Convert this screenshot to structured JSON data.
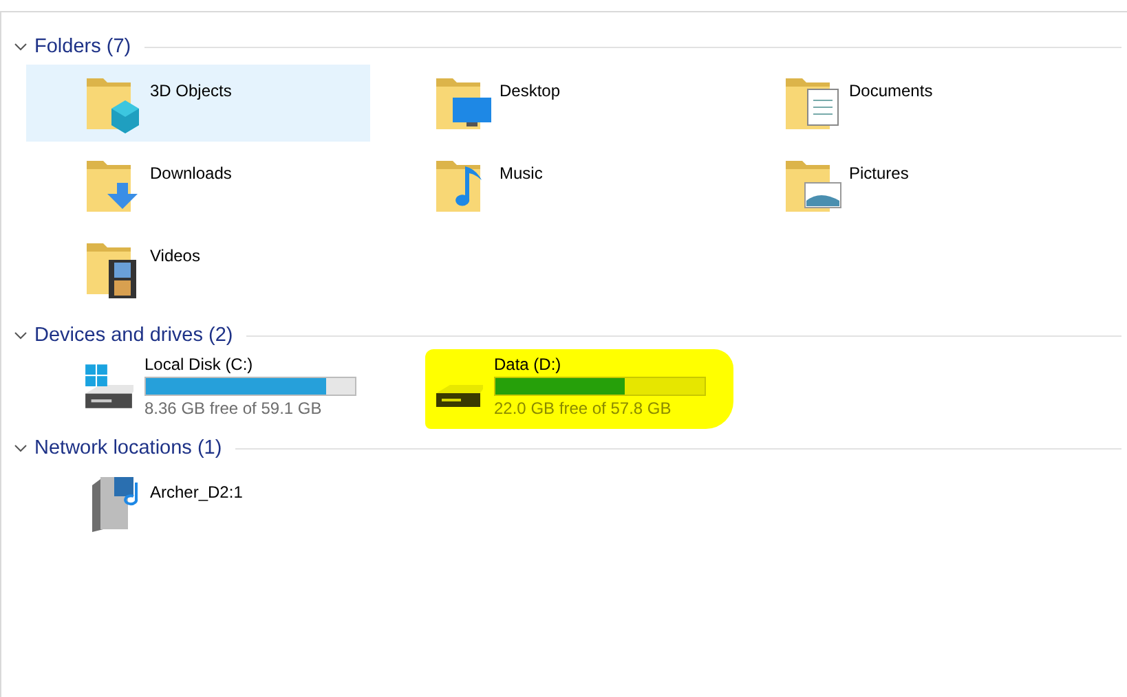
{
  "sections": [
    {
      "title": "Folders (7)",
      "expanded": true,
      "kind": "folders",
      "items": [
        {
          "name": "3D Objects",
          "kind": "cube",
          "selected": true
        },
        {
          "name": "Desktop",
          "kind": "desktop",
          "selected": false
        },
        {
          "name": "Documents",
          "kind": "document",
          "selected": false
        },
        {
          "name": "Downloads",
          "kind": "download",
          "selected": false
        },
        {
          "name": "Music",
          "kind": "music",
          "selected": false
        },
        {
          "name": "Pictures",
          "kind": "picture",
          "selected": false
        },
        {
          "name": "Videos",
          "kind": "film",
          "selected": false
        }
      ]
    },
    {
      "title": "Devices and drives (2)",
      "expanded": true,
      "kind": "drives",
      "items": [
        {
          "name": "Local Disk (C:)",
          "kind": "system",
          "level": 0.86,
          "free": "8.36 GB free of 59.1 GB",
          "highlighted": false
        },
        {
          "name": "Data (D:)",
          "kind": "plain",
          "level": 0.62,
          "free": "22.0 GB free of 57.8 GB",
          "highlighted": true
        }
      ]
    },
    {
      "title": "Network locations (1)",
      "expanded": true,
      "kind": "network",
      "items": [
        {
          "name": "Archer_D2:1",
          "kind": "media-server"
        }
      ]
    }
  ]
}
